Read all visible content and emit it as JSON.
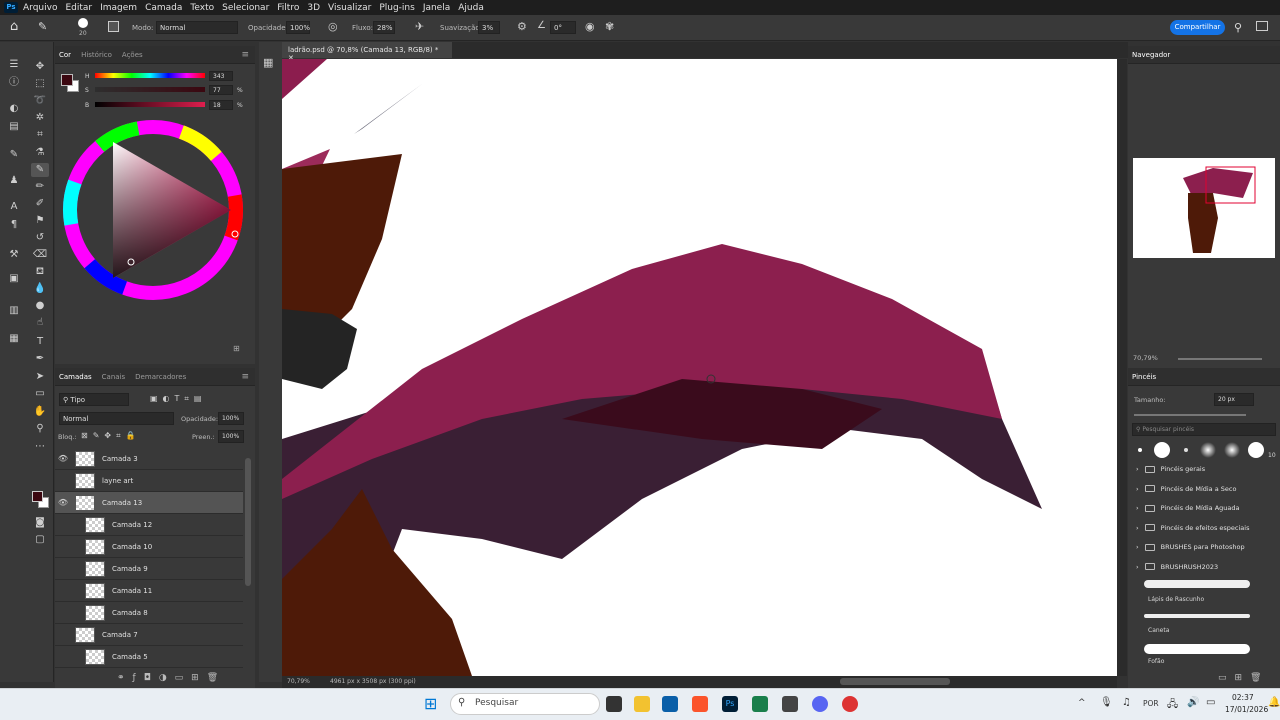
{
  "menu": {
    "items": [
      "Arquivo",
      "Editar",
      "Imagem",
      "Camada",
      "Texto",
      "Selecionar",
      "Filtro",
      "3D",
      "Visualizar",
      "Plug-ins",
      "Janela",
      "Ajuda"
    ]
  },
  "options": {
    "brush_size": "20",
    "mode_label": "Modo:",
    "mode_value": "Normal",
    "opacity_label": "Opacidade:",
    "opacity_value": "100%",
    "flow_label": "Fluxo:",
    "flow_value": "28%",
    "smoothing_label": "Suavização:",
    "smoothing_value": "3%",
    "angle_value": "0°",
    "share_label": "Compartilhar"
  },
  "color_panel": {
    "tabs": [
      "Cor",
      "Histórico",
      "Ações"
    ],
    "h_label": "H",
    "h_value": "343",
    "s_label": "S",
    "s_value": "77",
    "b_label": "B",
    "b_value": "18",
    "pct": "%",
    "foreground": "#3b0710",
    "background": "#ffffff"
  },
  "layers_panel": {
    "tabs": [
      "Camadas",
      "Canais",
      "Demarcadores"
    ],
    "filter_label": "Tipo",
    "blend_mode": "Normal",
    "opacity_label": "Opacidade:",
    "opacity_value": "100%",
    "lock_label": "Bloq.:",
    "fill_label": "Preen.:",
    "fill_value": "100%",
    "layers": [
      {
        "name": "Camada 3",
        "visible": true
      },
      {
        "name": "layne art",
        "visible": false
      },
      {
        "name": "Camada 13",
        "visible": true,
        "selected": true
      },
      {
        "name": "Camada 12",
        "clipped": true
      },
      {
        "name": "Camada 10",
        "clipped": true
      },
      {
        "name": "Camada 9",
        "clipped": true
      },
      {
        "name": "Camada 11",
        "clipped": true
      },
      {
        "name": "Camada 8",
        "clipped": true
      },
      {
        "name": "Camada 7"
      },
      {
        "name": "Camada 5",
        "clipped": true
      }
    ]
  },
  "document": {
    "tab_title": "ladrão.psd @ 70,8% (Camada 13, RGB/8) *",
    "zoom": "70,79%",
    "dimensions": "4961 px x 3508 px (300 ppi)"
  },
  "navigator": {
    "title": "Navegador",
    "zoom": "70,79%"
  },
  "brushes_panel": {
    "title": "Pincéis",
    "size_label": "Tamanho:",
    "size_value": "20 px",
    "search_placeholder": "Pesquisar pincéis",
    "preset_count": "10",
    "folders": [
      "Pincéis gerais",
      "Pincéis de Mídia a Seco",
      "Pincéis de Mídia Aguada",
      "Pincéis de efeitos especiais",
      "BRUSHES para Photoshop",
      "BRUSHRUSH2023"
    ],
    "brushes": [
      "Lápis de Rascunho",
      "Caneta",
      "Fofão"
    ]
  },
  "taskbar": {
    "search_label": "Pesquisar",
    "language": "POR",
    "time": "02:37",
    "date": "17/01/2026"
  }
}
